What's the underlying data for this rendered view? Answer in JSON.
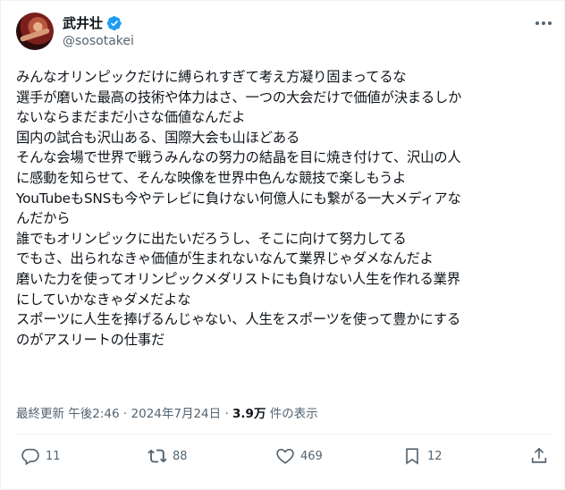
{
  "author": {
    "display_name": "武井壮",
    "handle": "@sosotakei",
    "verified": true
  },
  "tweet": {
    "lines": [
      "みんなオリンピックだけに縛られすぎて考え方凝り固まってるな",
      "選手が磨いた最高の技術や体力はさ、一つの大会だけで価値が決まるしか",
      "ないならまだまだ小さな価値なんだよ",
      "国内の試合も沢山ある、国際大会も山ほどある",
      "そんな会場で世界で戦うみんなの努力の結晶を目に焼き付けて、沢山の人",
      "に感動を知らせて、そんな映像を世界中色んな競技で楽しもうよ",
      "YouTubeもSNSも今やテレビに負けない何億人にも繋がる一大メディアな",
      "んだから",
      "誰でもオリンピックに出たいだろうし、そこに向けて努力してる",
      "でもさ、出られなきゃ価値が生まれないなんて業界じゃダメなんだよ",
      "磨いた力を使ってオリンピックメダリストにも負けない人生を作れる業界",
      "にしていかなきゃダメだよな",
      "スポーツに人生を捧げるんじゃない、人生をスポーツを使って豊かにする",
      "のがアスリートの仕事だ"
    ]
  },
  "meta": {
    "updated_label": "最終更新",
    "time": "午後2:46",
    "separator": "·",
    "date": "2024年7月24日",
    "views_count": "3.9万",
    "views_label": "件の表示"
  },
  "actions": {
    "replies": "11",
    "reposts": "88",
    "likes": "469",
    "bookmarks": "12"
  },
  "colors": {
    "text": "#0f1419",
    "secondary": "#536471",
    "verified_blue": "#1d9bf0",
    "border": "#eff3f4"
  },
  "icons": [
    "verified-badge-icon",
    "more-icon",
    "reply-icon",
    "repost-icon",
    "like-icon",
    "bookmark-icon",
    "share-icon"
  ]
}
